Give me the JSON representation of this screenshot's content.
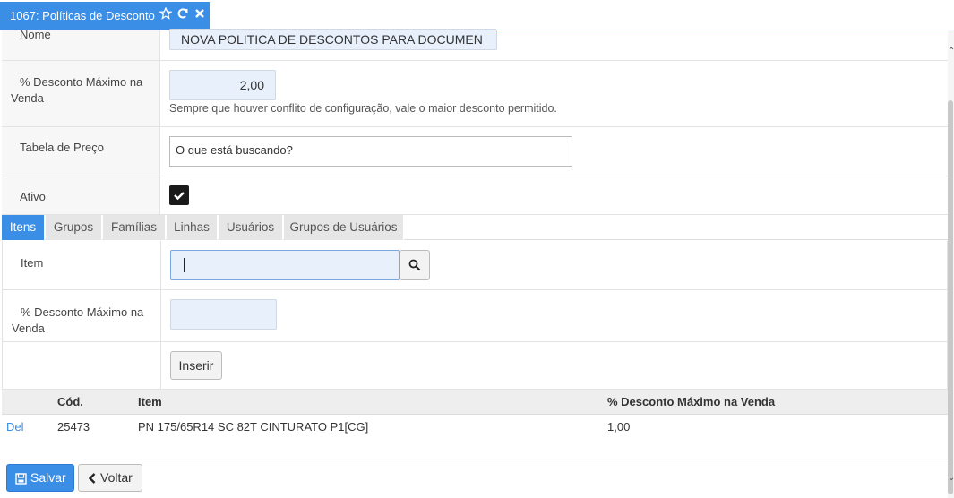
{
  "window": {
    "tab_title": "1067: Políticas de Desconto",
    "icons": [
      "star-icon",
      "refresh-icon",
      "close-icon"
    ]
  },
  "form": {
    "nome_label": "Nome",
    "nome_value": "NOVA POLITICA DE DESCONTOS PARA DOCUMEN",
    "desconto_label_1": "% Desconto Máximo na",
    "desconto_label_2": "Venda",
    "desconto_value": "2,00",
    "desconto_help": "Sempre que houver conflito de configuração, vale o maior desconto permitido.",
    "tabela_label": "Tabela de Preço",
    "tabela_placeholder": "O que está buscando?",
    "ativo_label": "Ativo",
    "ativo_checked": true
  },
  "tabs": [
    {
      "label": "Itens",
      "active": true
    },
    {
      "label": "Grupos",
      "active": false
    },
    {
      "label": "Famílias",
      "active": false
    },
    {
      "label": "Linhas",
      "active": false
    },
    {
      "label": "Usuários",
      "active": false
    },
    {
      "label": "Grupos de Usuários",
      "active": false
    }
  ],
  "itens_form": {
    "item_label": "Item",
    "item_value": "",
    "desconto_label_1": "% Desconto Máximo na",
    "desconto_label_2": "Venda",
    "desconto_value": "",
    "inserir_label": "Inserir"
  },
  "table": {
    "headers": [
      "",
      "Cód.",
      "Item",
      "% Desconto Máximo na Venda"
    ],
    "rows": [
      {
        "action": "Del",
        "cod": "25473",
        "item": "PN 175/65R14 SC 82T CINTURATO P1[CG]",
        "desconto": "1,00"
      }
    ]
  },
  "footer": {
    "salvar_label": "Salvar",
    "voltar_label": "Voltar"
  },
  "colors": {
    "accent": "#3a8ee6",
    "field_bg": "#e8f0fc"
  }
}
